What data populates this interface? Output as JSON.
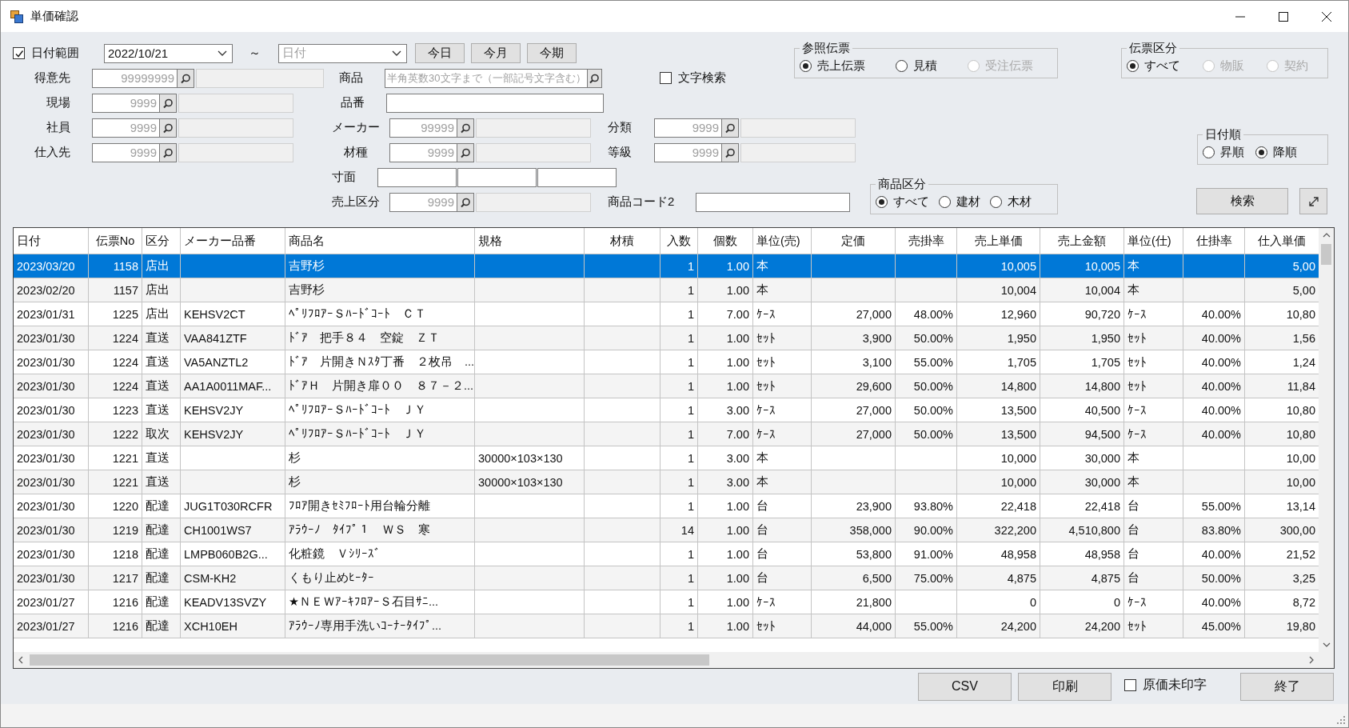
{
  "window": {
    "title": "単価確認"
  },
  "date_range": {
    "label": "日付範囲",
    "checked": true,
    "from": {
      "value": "2022/10/21"
    },
    "separator": "～",
    "to": {
      "placeholder": "日付"
    },
    "buttons": [
      "今日",
      "今月",
      "今期"
    ]
  },
  "customer": {
    "kind": "code",
    "label": "得意先",
    "placeholder": "99999999"
  },
  "site": {
    "kind": "code",
    "label": "現場",
    "placeholder": "9999"
  },
  "staff": {
    "kind": "code",
    "label": "社員",
    "placeholder": "9999"
  },
  "supplier": {
    "kind": "code",
    "label": "仕入先",
    "placeholder": "9999"
  },
  "product": {
    "kind": "search",
    "label": "商品",
    "placeholder": "半角英数30文字まで（一部記号文字含む）"
  },
  "text_search": {
    "label": "文字検索",
    "checked": false
  },
  "part_number": {
    "kind": "text",
    "label": "品番"
  },
  "maker": {
    "kind": "code",
    "label": "メーカー",
    "placeholder": "99999"
  },
  "category": {
    "kind": "code",
    "label": "分類",
    "placeholder": "9999"
  },
  "material": {
    "kind": "code",
    "label": "材種",
    "placeholder": "9999"
  },
  "grade": {
    "kind": "code",
    "label": "等級",
    "placeholder": "9999"
  },
  "dimensions": {
    "kind": "triple",
    "label": "寸面"
  },
  "sales_type": {
    "kind": "code",
    "label": "売上区分",
    "placeholder": "9999"
  },
  "product_code2": {
    "kind": "text",
    "label": "商品コード2"
  },
  "reference_slip": {
    "title": "参照伝票",
    "options": [
      {
        "label": "売上伝票",
        "selected": true,
        "disabled": false
      },
      {
        "label": "見積",
        "selected": false,
        "disabled": false
      },
      {
        "label": "受注伝票",
        "selected": false,
        "disabled": true
      }
    ]
  },
  "slip_type": {
    "title": "伝票区分",
    "options": [
      {
        "label": "すべて",
        "selected": true,
        "disabled": false
      },
      {
        "label": "物販",
        "selected": false,
        "disabled": true
      },
      {
        "label": "契約",
        "selected": false,
        "disabled": true
      }
    ]
  },
  "date_order": {
    "title": "日付順",
    "options": [
      {
        "label": "昇順",
        "selected": false,
        "disabled": false
      },
      {
        "label": "降順",
        "selected": true,
        "disabled": false
      }
    ]
  },
  "product_type": {
    "title": "商品区分",
    "options": [
      {
        "label": "すべて",
        "selected": true,
        "disabled": false
      },
      {
        "label": "建材",
        "selected": false,
        "disabled": false
      },
      {
        "label": "木材",
        "selected": false,
        "disabled": false
      }
    ]
  },
  "search_button": "検索",
  "table": {
    "columns": [
      "日付",
      "伝票No",
      "区分",
      "メーカー品番",
      "商品名",
      "規格",
      "材積",
      "入数",
      "個数",
      "単位(売)",
      "定価",
      "売掛率",
      "売上単価",
      "売上金額",
      "単位(仕)",
      "仕掛率",
      "仕入単価"
    ],
    "rows": [
      {
        "selected": true,
        "cells": [
          "2023/03/20",
          "1158",
          "店出",
          null,
          "吉野杉",
          null,
          null,
          "1",
          "1.00",
          "本",
          null,
          null,
          "10,005",
          "10,005",
          "本",
          null,
          "5,00"
        ]
      },
      {
        "selected": false,
        "cells": [
          "2023/02/20",
          "1157",
          "店出",
          null,
          "吉野杉",
          null,
          null,
          "1",
          "1.00",
          "本",
          null,
          null,
          "10,004",
          "10,004",
          "本",
          null,
          "5,00"
        ]
      },
      {
        "selected": false,
        "cells": [
          "2023/01/31",
          "1225",
          "店出",
          "KEHSV2CT",
          "ﾍﾟﾘﾌﾛｱｰＳﾊｰﾄﾞｺｰﾄ　ＣＴ",
          null,
          null,
          "1",
          "7.00",
          "ｹｰｽ",
          "27,000",
          "48.00%",
          "12,960",
          "90,720",
          "ｹｰｽ",
          "40.00%",
          "10,80"
        ]
      },
      {
        "selected": false,
        "cells": [
          "2023/01/30",
          "1224",
          "直送",
          "VAA841ZTF",
          "ﾄﾞｱ　把手８４　空錠　ＺＴ",
          null,
          null,
          "1",
          "1.00",
          "ｾｯﾄ",
          "3,900",
          "50.00%",
          "1,950",
          "1,950",
          "ｾｯﾄ",
          "40.00%",
          "1,56"
        ]
      },
      {
        "selected": false,
        "cells": [
          "2023/01/30",
          "1224",
          "直送",
          "VA5ANZTL2",
          "ﾄﾞｱ　片開きＮｽﾀ丁番　２枚吊　...",
          null,
          null,
          "1",
          "1.00",
          "ｾｯﾄ",
          "3,100",
          "55.00%",
          "1,705",
          "1,705",
          "ｾｯﾄ",
          "40.00%",
          "1,24"
        ]
      },
      {
        "selected": false,
        "cells": [
          "2023/01/30",
          "1224",
          "直送",
          "AA1A0011MAF...",
          "ﾄﾞｱＨ　片開き扉００　８７－２...",
          null,
          null,
          "1",
          "1.00",
          "ｾｯﾄ",
          "29,600",
          "50.00%",
          "14,800",
          "14,800",
          "ｾｯﾄ",
          "40.00%",
          "11,84"
        ]
      },
      {
        "selected": false,
        "cells": [
          "2023/01/30",
          "1223",
          "直送",
          "KEHSV2JY",
          "ﾍﾟﾘﾌﾛｱｰＳﾊｰﾄﾞｺｰﾄ　ＪＹ",
          null,
          null,
          "1",
          "3.00",
          "ｹｰｽ",
          "27,000",
          "50.00%",
          "13,500",
          "40,500",
          "ｹｰｽ",
          "40.00%",
          "10,80"
        ]
      },
      {
        "selected": false,
        "cells": [
          "2023/01/30",
          "1222",
          "取次",
          "KEHSV2JY",
          "ﾍﾟﾘﾌﾛｱｰＳﾊｰﾄﾞｺｰﾄ　ＪＹ",
          null,
          null,
          "1",
          "7.00",
          "ｹｰｽ",
          "27,000",
          "50.00%",
          "13,500",
          "94,500",
          "ｹｰｽ",
          "40.00%",
          "10,80"
        ]
      },
      {
        "selected": false,
        "cells": [
          "2023/01/30",
          "1221",
          "直送",
          null,
          "杉",
          "30000×103×130",
          null,
          "1",
          "3.00",
          "本",
          null,
          null,
          "10,000",
          "30,000",
          "本",
          null,
          "10,00"
        ]
      },
      {
        "selected": false,
        "cells": [
          "2023/01/30",
          "1221",
          "直送",
          null,
          "杉",
          "30000×103×130",
          null,
          "1",
          "3.00",
          "本",
          null,
          null,
          "10,000",
          "30,000",
          "本",
          null,
          "10,00"
        ]
      },
      {
        "selected": false,
        "cells": [
          "2023/01/30",
          "1220",
          "配達",
          "JUG1T030RCFR",
          "ﾌﾛｱ開きｾﾐﾌﾛｰﾄ用台輪分離",
          null,
          null,
          "1",
          "1.00",
          "台",
          "23,900",
          "93.80%",
          "22,418",
          "22,418",
          "台",
          "55.00%",
          "13,14"
        ]
      },
      {
        "selected": false,
        "cells": [
          "2023/01/30",
          "1219",
          "配達",
          "CH1001WS7",
          "ｱﾗｳｰﾉ　ﾀｲﾌﾟ１　ＷＳ　寒",
          null,
          null,
          "14",
          "1.00",
          "台",
          "358,000",
          "90.00%",
          "322,200",
          "4,510,800",
          "台",
          "83.80%",
          "300,00"
        ]
      },
      {
        "selected": false,
        "cells": [
          "2023/01/30",
          "1218",
          "配達",
          "LMPB060B2G...",
          "化粧鏡　Ｖｼﾘｰｽﾞ",
          null,
          null,
          "1",
          "1.00",
          "台",
          "53,800",
          "91.00%",
          "48,958",
          "48,958",
          "台",
          "40.00%",
          "21,52"
        ]
      },
      {
        "selected": false,
        "cells": [
          "2023/01/30",
          "1217",
          "配達",
          "CSM-KH2",
          "くもり止めﾋｰﾀｰ",
          null,
          null,
          "1",
          "1.00",
          "台",
          "6,500",
          "75.00%",
          "4,875",
          "4,875",
          "台",
          "50.00%",
          "3,25"
        ]
      },
      {
        "selected": false,
        "cells": [
          "2023/01/27",
          "1216",
          "配達",
          "KEADV13SVZY",
          "★ＮＥＷｱｰｷﾌﾛｱｰＳ石目ｻﾆ...",
          null,
          null,
          "1",
          "1.00",
          "ｹｰｽ",
          "21,800",
          null,
          "0",
          "0",
          "ｹｰｽ",
          "40.00%",
          "8,72"
        ]
      },
      {
        "selected": false,
        "cells": [
          "2023/01/27",
          "1216",
          "配達",
          "XCH10EH",
          "ｱﾗｳｰﾉ専用手洗いｺｰﾅｰﾀｲﾌﾟ...",
          null,
          null,
          "1",
          "1.00",
          "ｾｯﾄ",
          "44,000",
          "55.00%",
          "24,200",
          "24,200",
          "ｾｯﾄ",
          "45.00%",
          "19,80"
        ]
      }
    ]
  },
  "footer": {
    "buttons": [
      "CSV",
      "印刷"
    ],
    "checkbox": {
      "label": "原価未印字",
      "checked": false
    },
    "close_button": "終了"
  }
}
